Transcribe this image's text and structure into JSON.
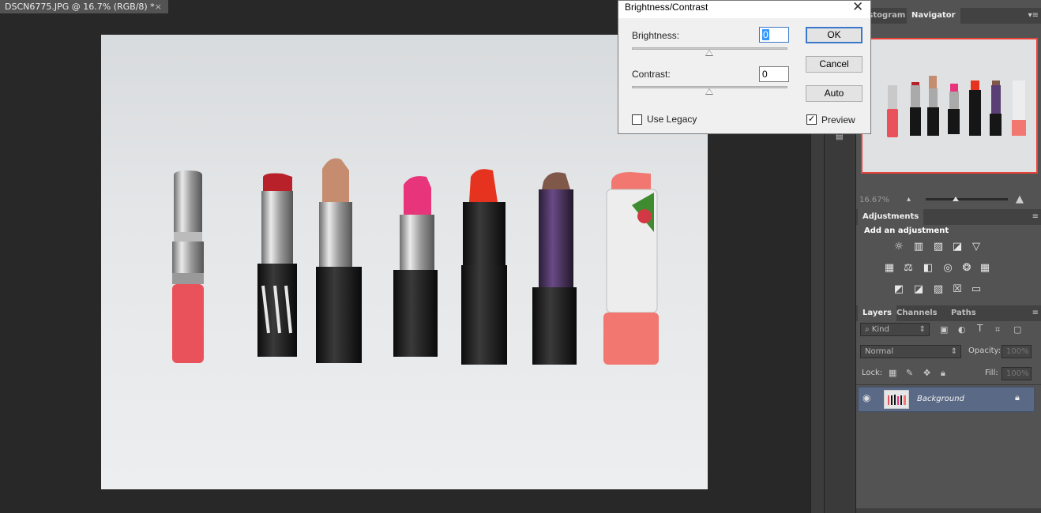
{
  "document": {
    "tab_title": "DSCN6775.JPG @ 16.7% (RGB/8) *",
    "close_glyph": "×"
  },
  "panels": {
    "top_tabs": [
      "istogram",
      "Navigator"
    ],
    "navigator": {
      "zoom": "16.67%"
    },
    "adjustments": {
      "tab": "Adjustments",
      "title": "Add an adjustment"
    },
    "layers": {
      "tabs": [
        "Layers",
        "Channels",
        "Paths"
      ],
      "kind_filter": "Kind",
      "blend_mode": "Normal",
      "opacity_label": "Opacity:",
      "opacity_value": "100%",
      "lock_label": "Lock:",
      "fill_label": "Fill:",
      "fill_value": "100%",
      "layer_name": "Background"
    }
  },
  "dialog": {
    "title": "Brightness/Contrast",
    "brightness_label": "Brightness:",
    "brightness_value": "0",
    "contrast_label": "Contrast:",
    "contrast_value": "0",
    "ok_label": "OK",
    "cancel_label": "Cancel",
    "auto_label": "Auto",
    "use_legacy_label": "Use Legacy",
    "use_legacy_checked": false,
    "preview_label": "Preview",
    "preview_checked": true
  },
  "colors": {
    "panel_bg": "#535353",
    "canvas_bg": "#282828",
    "layer_selected": "#5a6a86",
    "nav_frame": "#e8433a"
  }
}
